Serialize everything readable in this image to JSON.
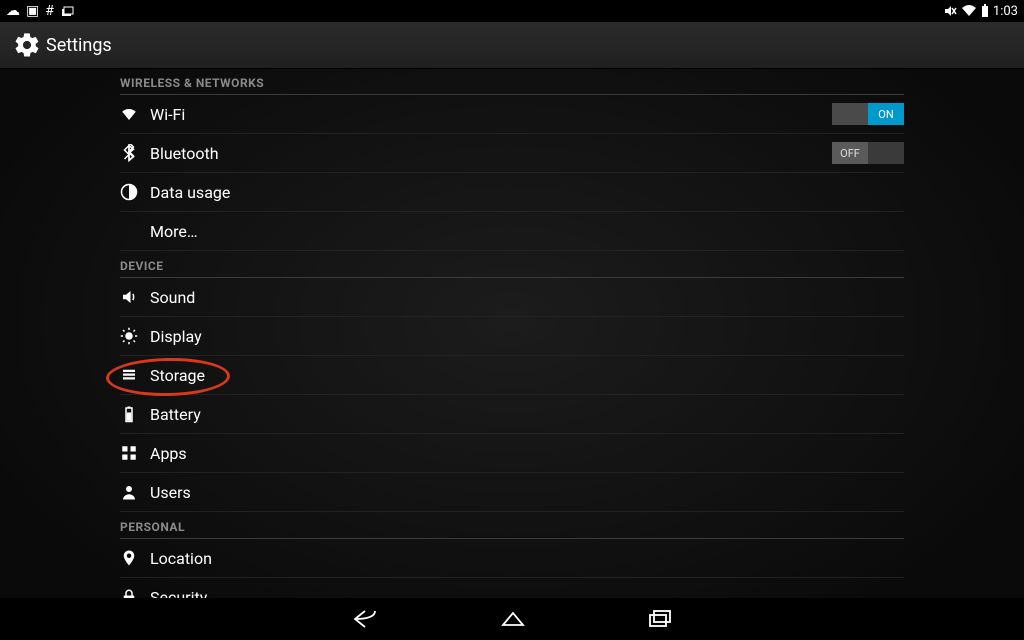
{
  "status": {
    "time": "1:03"
  },
  "title": "Settings",
  "toggle_labels": {
    "on": "ON",
    "off": "OFF"
  },
  "sections": [
    {
      "header": "WIRELESS & NETWORKS",
      "items": [
        {
          "icon": "wifi",
          "label": "Wi-Fi",
          "toggle": "on"
        },
        {
          "icon": "bluetooth",
          "label": "Bluetooth",
          "toggle": "off"
        },
        {
          "icon": "data",
          "label": "Data usage"
        },
        {
          "icon": "",
          "label": "More…"
        }
      ]
    },
    {
      "header": "DEVICE",
      "items": [
        {
          "icon": "sound",
          "label": "Sound"
        },
        {
          "icon": "display",
          "label": "Display"
        },
        {
          "icon": "storage",
          "label": "Storage",
          "highlight": true
        },
        {
          "icon": "battery",
          "label": "Battery"
        },
        {
          "icon": "apps",
          "label": "Apps"
        },
        {
          "icon": "users",
          "label": "Users"
        }
      ]
    },
    {
      "header": "PERSONAL",
      "items": [
        {
          "icon": "location",
          "label": "Location"
        },
        {
          "icon": "security",
          "label": "Security"
        }
      ]
    }
  ]
}
